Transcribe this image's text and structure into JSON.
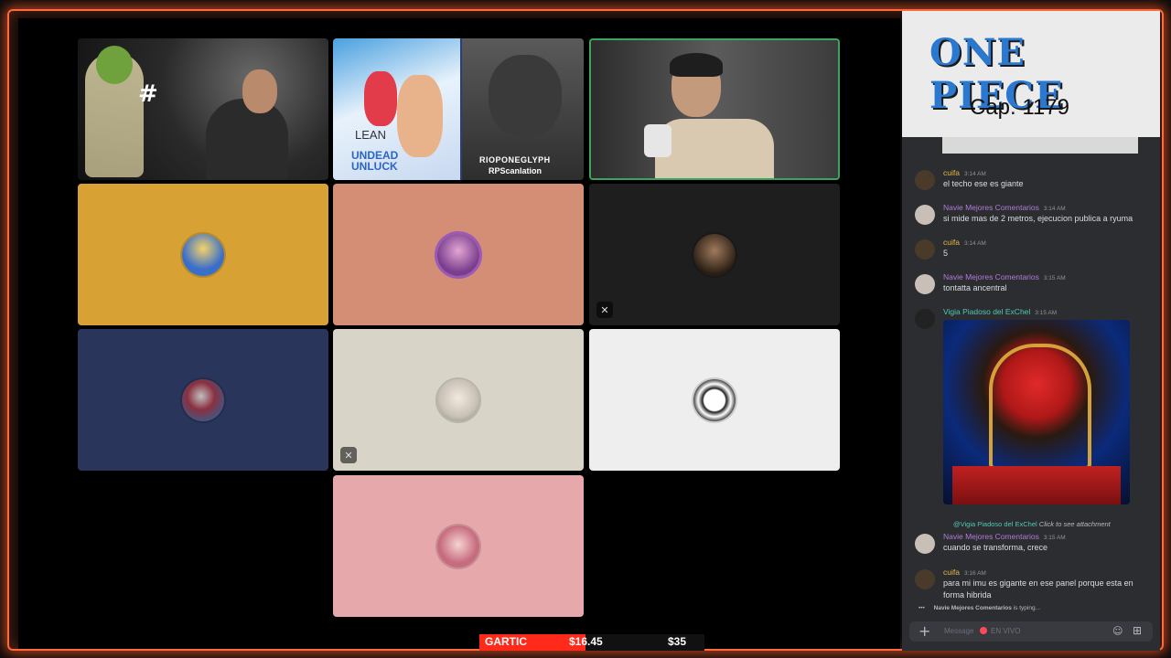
{
  "colors": {
    "accent": "#ff6a3d",
    "discord_bg": "#2b2d31",
    "name_purple": "#b47bd6",
    "name_yellow": "#e4b84a",
    "name_teal": "#52c9b0"
  },
  "tiles": [
    {
      "id": "t1",
      "bg": "#1c1c1c",
      "type": "camera"
    },
    {
      "id": "t2",
      "bg": "#2a3e7a",
      "type": "camera"
    },
    {
      "id": "t3",
      "bg": "#3a3a3a",
      "type": "camera"
    },
    {
      "id": "t4",
      "bg": "#d7a233",
      "type": "avatar",
      "avatar": "#3a6fc9",
      "muted": false
    },
    {
      "id": "t5",
      "bg": "#d48e76",
      "type": "avatar",
      "avatar": "#7a3e8f",
      "muted": false
    },
    {
      "id": "t6",
      "bg": "#1e1e1e",
      "type": "avatar",
      "avatar": "#4a3a2a",
      "muted": true
    },
    {
      "id": "t7",
      "bg": "#29355a",
      "type": "avatar",
      "avatar": "#8a3040",
      "muted": false
    },
    {
      "id": "t8",
      "bg": "#d8d4c8",
      "type": "avatar",
      "avatar": "#c8c0b6",
      "muted": true
    },
    {
      "id": "t9",
      "bg": "#eeeeee",
      "type": "avatar",
      "avatar": "#222222",
      "muted": false
    },
    {
      "id": "t10",
      "bg": "#e7a8ac",
      "type": "avatar",
      "avatar": "#c76b7f",
      "muted": false
    }
  ],
  "overlay_texts": {
    "hash": "#",
    "lean": "LEAN",
    "manga_title": "UNDEAD UNLUCK",
    "rio": "RIOPONEGLYPH",
    "rps": "RPScanlation"
  },
  "brand": {
    "title": "ONE PIECE",
    "chapter": "Cap. 1179"
  },
  "chat": [
    {
      "user": "cuifa",
      "time": "3:14 AM",
      "text": "el techo ese es giante",
      "color": "#e4b84a"
    },
    {
      "user": "Navie Mejores Comentarios",
      "time": "3:14 AM",
      "text": "si mide mas de 2 metros, ejecucion publica a ryuma",
      "color": "#b47bd6"
    },
    {
      "user": "cuifa",
      "time": "3:14 AM",
      "text": "5",
      "color": "#e4b84a"
    },
    {
      "user": "Navie Mejores Comentarios",
      "time": "3:15 AM",
      "text": "tontatta ancentral",
      "color": "#b47bd6"
    },
    {
      "user": "Vigia Piadoso del ExChel",
      "time": "3:15 AM",
      "text": "",
      "color": "#52c9b0"
    },
    {
      "user": "Navie Mejores Comentarios",
      "time": "3:15 AM",
      "text": "cuando se transforma, crece",
      "color": "#b47bd6"
    },
    {
      "user": "cuifa",
      "time": "3:16 AM",
      "text": "para mi imu es gigante en ese panel porque esta en forma hibrida",
      "color": "#e4b84a"
    }
  ],
  "reply": {
    "mention": "@Vigia Piadoso del ExChel",
    "action": "Click to see attachment"
  },
  "typing": {
    "user": "Navie Mejores Comentarios",
    "suffix": "is typing..."
  },
  "input": {
    "placeholder": "Message",
    "live": "EN VIVO"
  },
  "bottom": {
    "label": "GARTIC",
    "amount1": "$16.45",
    "amount2": "$35",
    "progress": 0.47
  }
}
